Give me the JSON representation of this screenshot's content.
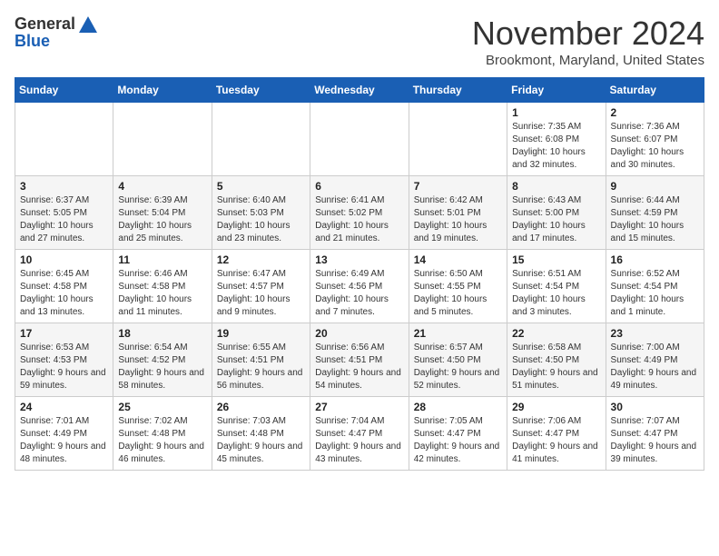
{
  "header": {
    "logo_general": "General",
    "logo_blue": "Blue",
    "month_title": "November 2024",
    "location": "Brookmont, Maryland, United States"
  },
  "weekdays": [
    "Sunday",
    "Monday",
    "Tuesday",
    "Wednesday",
    "Thursday",
    "Friday",
    "Saturday"
  ],
  "weeks": [
    [
      {
        "day": "",
        "info": ""
      },
      {
        "day": "",
        "info": ""
      },
      {
        "day": "",
        "info": ""
      },
      {
        "day": "",
        "info": ""
      },
      {
        "day": "",
        "info": ""
      },
      {
        "day": "1",
        "info": "Sunrise: 7:35 AM\nSunset: 6:08 PM\nDaylight: 10 hours and 32 minutes."
      },
      {
        "day": "2",
        "info": "Sunrise: 7:36 AM\nSunset: 6:07 PM\nDaylight: 10 hours and 30 minutes."
      }
    ],
    [
      {
        "day": "3",
        "info": "Sunrise: 6:37 AM\nSunset: 5:05 PM\nDaylight: 10 hours and 27 minutes."
      },
      {
        "day": "4",
        "info": "Sunrise: 6:39 AM\nSunset: 5:04 PM\nDaylight: 10 hours and 25 minutes."
      },
      {
        "day": "5",
        "info": "Sunrise: 6:40 AM\nSunset: 5:03 PM\nDaylight: 10 hours and 23 minutes."
      },
      {
        "day": "6",
        "info": "Sunrise: 6:41 AM\nSunset: 5:02 PM\nDaylight: 10 hours and 21 minutes."
      },
      {
        "day": "7",
        "info": "Sunrise: 6:42 AM\nSunset: 5:01 PM\nDaylight: 10 hours and 19 minutes."
      },
      {
        "day": "8",
        "info": "Sunrise: 6:43 AM\nSunset: 5:00 PM\nDaylight: 10 hours and 17 minutes."
      },
      {
        "day": "9",
        "info": "Sunrise: 6:44 AM\nSunset: 4:59 PM\nDaylight: 10 hours and 15 minutes."
      }
    ],
    [
      {
        "day": "10",
        "info": "Sunrise: 6:45 AM\nSunset: 4:58 PM\nDaylight: 10 hours and 13 minutes."
      },
      {
        "day": "11",
        "info": "Sunrise: 6:46 AM\nSunset: 4:58 PM\nDaylight: 10 hours and 11 minutes."
      },
      {
        "day": "12",
        "info": "Sunrise: 6:47 AM\nSunset: 4:57 PM\nDaylight: 10 hours and 9 minutes."
      },
      {
        "day": "13",
        "info": "Sunrise: 6:49 AM\nSunset: 4:56 PM\nDaylight: 10 hours and 7 minutes."
      },
      {
        "day": "14",
        "info": "Sunrise: 6:50 AM\nSunset: 4:55 PM\nDaylight: 10 hours and 5 minutes."
      },
      {
        "day": "15",
        "info": "Sunrise: 6:51 AM\nSunset: 4:54 PM\nDaylight: 10 hours and 3 minutes."
      },
      {
        "day": "16",
        "info": "Sunrise: 6:52 AM\nSunset: 4:54 PM\nDaylight: 10 hours and 1 minute."
      }
    ],
    [
      {
        "day": "17",
        "info": "Sunrise: 6:53 AM\nSunset: 4:53 PM\nDaylight: 9 hours and 59 minutes."
      },
      {
        "day": "18",
        "info": "Sunrise: 6:54 AM\nSunset: 4:52 PM\nDaylight: 9 hours and 58 minutes."
      },
      {
        "day": "19",
        "info": "Sunrise: 6:55 AM\nSunset: 4:51 PM\nDaylight: 9 hours and 56 minutes."
      },
      {
        "day": "20",
        "info": "Sunrise: 6:56 AM\nSunset: 4:51 PM\nDaylight: 9 hours and 54 minutes."
      },
      {
        "day": "21",
        "info": "Sunrise: 6:57 AM\nSunset: 4:50 PM\nDaylight: 9 hours and 52 minutes."
      },
      {
        "day": "22",
        "info": "Sunrise: 6:58 AM\nSunset: 4:50 PM\nDaylight: 9 hours and 51 minutes."
      },
      {
        "day": "23",
        "info": "Sunrise: 7:00 AM\nSunset: 4:49 PM\nDaylight: 9 hours and 49 minutes."
      }
    ],
    [
      {
        "day": "24",
        "info": "Sunrise: 7:01 AM\nSunset: 4:49 PM\nDaylight: 9 hours and 48 minutes."
      },
      {
        "day": "25",
        "info": "Sunrise: 7:02 AM\nSunset: 4:48 PM\nDaylight: 9 hours and 46 minutes."
      },
      {
        "day": "26",
        "info": "Sunrise: 7:03 AM\nSunset: 4:48 PM\nDaylight: 9 hours and 45 minutes."
      },
      {
        "day": "27",
        "info": "Sunrise: 7:04 AM\nSunset: 4:47 PM\nDaylight: 9 hours and 43 minutes."
      },
      {
        "day": "28",
        "info": "Sunrise: 7:05 AM\nSunset: 4:47 PM\nDaylight: 9 hours and 42 minutes."
      },
      {
        "day": "29",
        "info": "Sunrise: 7:06 AM\nSunset: 4:47 PM\nDaylight: 9 hours and 41 minutes."
      },
      {
        "day": "30",
        "info": "Sunrise: 7:07 AM\nSunset: 4:47 PM\nDaylight: 9 hours and 39 minutes."
      }
    ]
  ]
}
